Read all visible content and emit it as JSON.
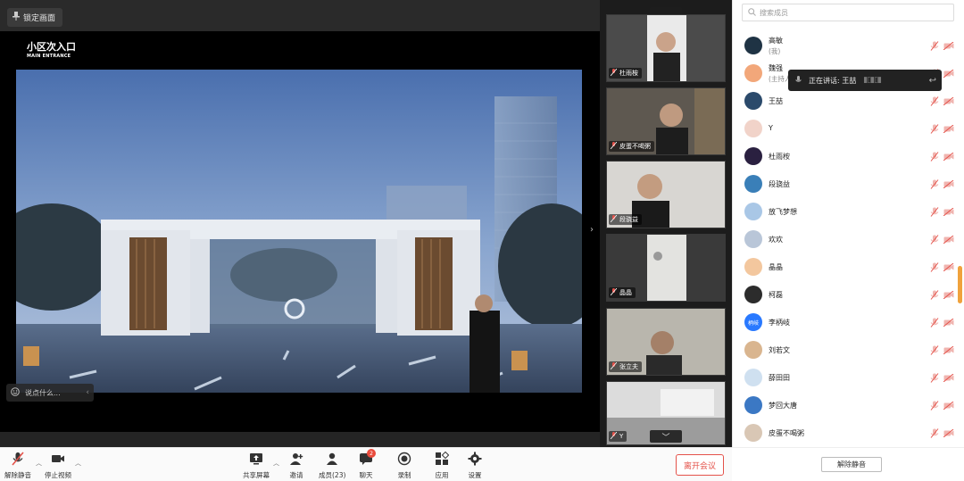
{
  "stage": {
    "lock_label": "锁定画面",
    "slide_title": "小区次入口",
    "slide_subtitle": "MAIN ENTRANCE",
    "chat_placeholder": "说点什么..."
  },
  "video_tiles": [
    {
      "name": "杜雨桉"
    },
    {
      "name": "皮蛋不喝粥"
    },
    {
      "name": "段骁益"
    },
    {
      "name": "晶晶"
    },
    {
      "name": "张立夫"
    },
    {
      "name": "Y"
    }
  ],
  "members_panel": {
    "search_placeholder": "搜索成员",
    "speaking_label": "正在讲话: 王喆",
    "unmute_all_label": "解除静音",
    "members": [
      {
        "name": "高敏",
        "note": "(我)"
      },
      {
        "name": "魏强",
        "note": "(主持人)"
      },
      {
        "name": "王喆",
        "note": ""
      },
      {
        "name": "Y",
        "note": ""
      },
      {
        "name": "杜雨桉",
        "note": ""
      },
      {
        "name": "段骁益",
        "note": ""
      },
      {
        "name": "放飞梦想",
        "note": ""
      },
      {
        "name": "欢欢",
        "note": ""
      },
      {
        "name": "晶晶",
        "note": ""
      },
      {
        "name": "柯磊",
        "note": ""
      },
      {
        "name": "李柄岐",
        "note": "",
        "avatar_text": "柄岐"
      },
      {
        "name": "刘若文",
        "note": ""
      },
      {
        "name": "薛田田",
        "note": ""
      },
      {
        "name": "梦回大唐",
        "note": ""
      },
      {
        "name": "皮蛋不喝粥",
        "note": ""
      }
    ]
  },
  "toolbar": {
    "unmute_label": "解除静音",
    "stop_video_label": "停止视频",
    "share_screen_label": "共享屏幕",
    "invite_label": "邀请",
    "members_label": "成员(23)",
    "chat_label": "聊天",
    "chat_badge": "2",
    "record_label": "录制",
    "apps_label": "应用",
    "settings_label": "设置",
    "leave_label": "离开会议"
  },
  "colors": {
    "accent_red": "#e4524a",
    "scroll_thumb": "#f0a23c"
  }
}
